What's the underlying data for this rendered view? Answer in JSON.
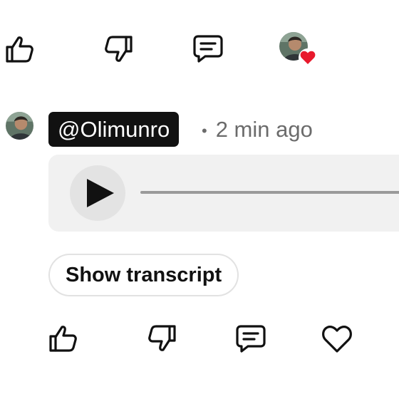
{
  "top_actions": {
    "like_icon": "thumbs-up-icon",
    "dislike_icon": "thumbs-down-icon",
    "comment_icon": "comment-icon",
    "reaction_icon": "heart-icon",
    "heart_color": "#e8192c"
  },
  "comment": {
    "username": "@Olimunro",
    "separator": "•",
    "timestamp": "2 min ago",
    "audio": {
      "play_icon": "play-icon",
      "progress": 0
    },
    "show_transcript_label": "Show transcript"
  },
  "bottom_actions": {
    "like_icon": "thumbs-up-icon",
    "dislike_icon": "thumbs-down-icon",
    "comment_icon": "comment-icon",
    "heart_icon": "heart-outline-icon"
  },
  "colors": {
    "username_bg": "#111111",
    "audio_bg": "#f1f1f1",
    "meta_text": "#6b6b6b"
  }
}
